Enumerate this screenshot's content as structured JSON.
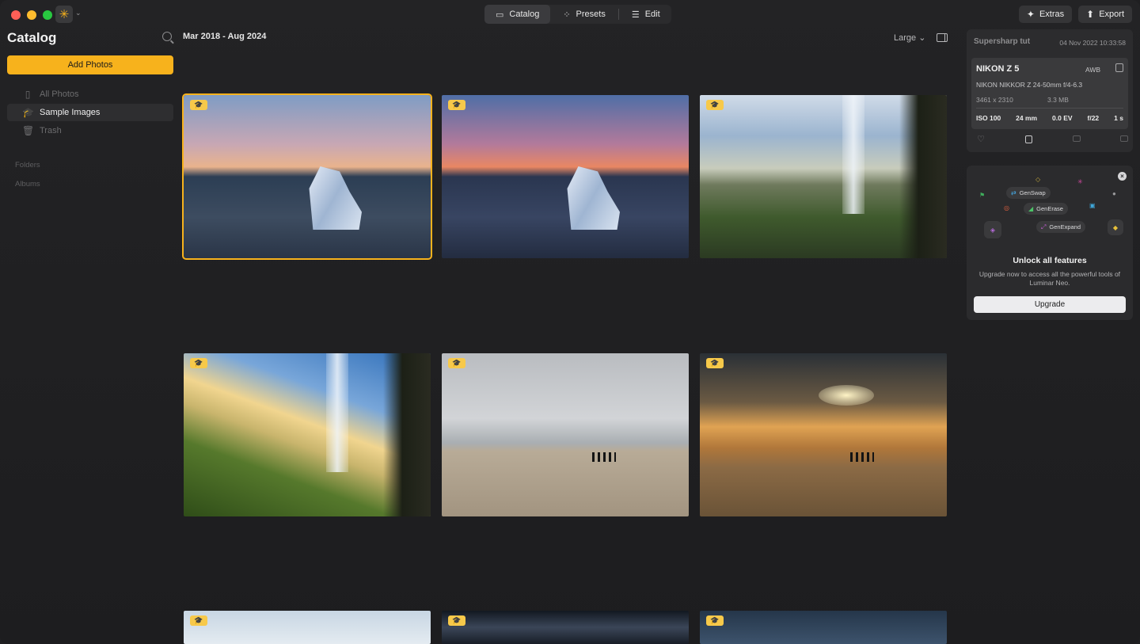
{
  "titlebar": {
    "tabs": [
      {
        "label": "Catalog",
        "icon": "folder-icon",
        "active": true
      },
      {
        "label": "Presets",
        "icon": "sparkle-icon",
        "active": false
      },
      {
        "label": "Edit",
        "icon": "sliders-icon",
        "active": false
      }
    ],
    "extras_label": "Extras",
    "export_label": "Export"
  },
  "sidebar": {
    "title": "Catalog",
    "add_photos_label": "Add Photos",
    "items": [
      {
        "label": "All Photos",
        "icon": "photos-icon",
        "active": false
      },
      {
        "label": "Sample Images",
        "icon": "graduation-cap-icon",
        "active": true
      },
      {
        "label": "Trash",
        "icon": "trash-icon",
        "active": false
      }
    ],
    "sections": [
      "Folders",
      "Albums"
    ]
  },
  "main": {
    "date_range": "Mar 2018 - Aug 2024",
    "size_option": "Large",
    "thumbnails": [
      {
        "scene": "iceberg-sunset-soft",
        "selected": true
      },
      {
        "scene": "iceberg-sunset-vivid",
        "selected": false
      },
      {
        "scene": "waterfall-cave-day",
        "selected": false
      },
      {
        "scene": "waterfall-cave-sunset",
        "selected": false
      },
      {
        "scene": "beach-overcast-people",
        "selected": false
      },
      {
        "scene": "beach-golden-people",
        "selected": false
      },
      {
        "scene": "snow-sky",
        "selected": false
      },
      {
        "scene": "milky-way",
        "selected": false
      },
      {
        "scene": "sea-rocks",
        "selected": false
      }
    ]
  },
  "info_panel": {
    "title": "Supersharp tut",
    "date": "04 Nov 2022 10:33:58",
    "camera": "NIKON Z 5",
    "white_balance": "AWB",
    "lens": "NIKON NIKKOR Z 24-50mm f/4-6.3",
    "dimensions": "3461 x 2310",
    "file_size": "3.3 MB",
    "iso": "ISO 100",
    "focal_length": "24 mm",
    "exposure": "0.0 EV",
    "aperture": "f/22",
    "shutter": "1 s"
  },
  "promo": {
    "features": [
      "GenSwap",
      "GenErase",
      "GenExpand"
    ],
    "title": "Unlock all features",
    "description": "Upgrade now to access all the powerful tools of Luminar Neo.",
    "upgrade_label": "Upgrade"
  },
  "colors": {
    "accent": "#f7b21c",
    "background": "#1f1f21",
    "panel": "#2c2c2e"
  }
}
